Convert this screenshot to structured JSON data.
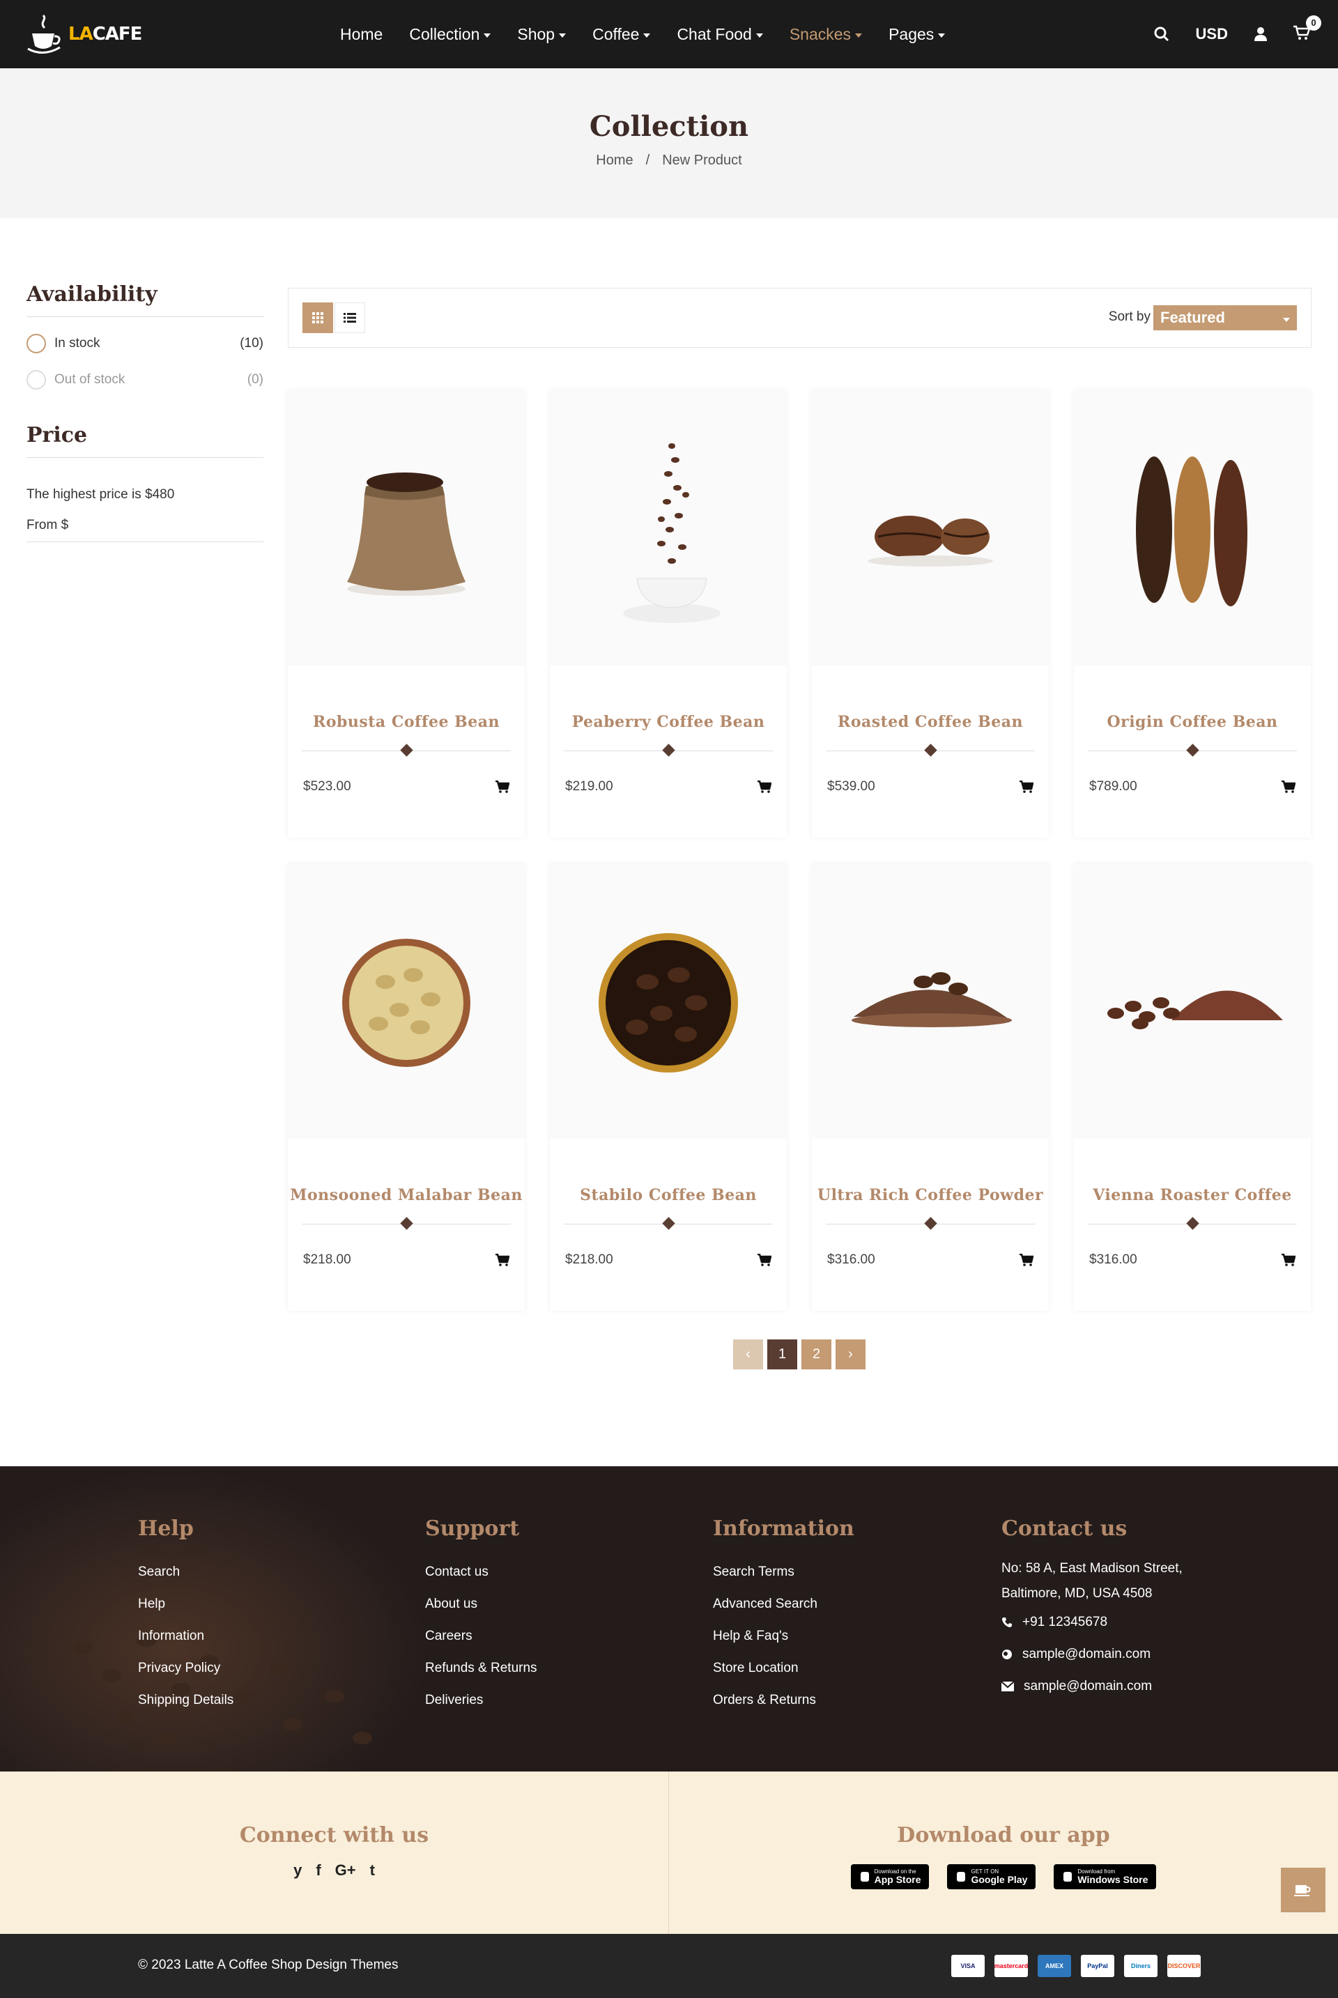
{
  "header": {
    "logo_prefix": "LA",
    "logo_suffix": "CAFE",
    "nav": [
      {
        "label": "Home",
        "dropdown": false,
        "active": false
      },
      {
        "label": "Collection",
        "dropdown": true,
        "active": false
      },
      {
        "label": "Shop",
        "dropdown": true,
        "active": false
      },
      {
        "label": "Coffee",
        "dropdown": true,
        "active": false
      },
      {
        "label": "Chat Food",
        "dropdown": true,
        "active": false
      },
      {
        "label": "Snackes",
        "dropdown": true,
        "active": true
      },
      {
        "label": "Pages",
        "dropdown": true,
        "active": false
      }
    ],
    "currency": "USD",
    "cart_count": "0"
  },
  "title_band": {
    "title": "Collection",
    "breadcrumb": [
      "Home",
      "/",
      "New Product"
    ]
  },
  "sidebar": {
    "availability_heading": "Availability",
    "availability": [
      {
        "label": "In stock",
        "count": "(10)"
      },
      {
        "label": "Out of stock",
        "count": "(0)"
      }
    ],
    "price_heading": "Price",
    "highest_price": "The highest price is $480",
    "from_label": "From $"
  },
  "toolbar": {
    "sort_label": "Sort by",
    "sort_value": "Featured"
  },
  "products": [
    {
      "name": "Robusta Coffee Bean",
      "price": "$523.00",
      "image": "coffee-sack"
    },
    {
      "name": "Peaberry Coffee Bean",
      "price": "$219.00",
      "image": "coffee-cup-beans"
    },
    {
      "name": "Roasted Coffee Bean",
      "price": "$539.00",
      "image": "two-beans"
    },
    {
      "name": "Origin Coffee Bean",
      "price": "$789.00",
      "image": "three-columns"
    },
    {
      "name": "Monsooned Malabar Bean",
      "price": "$218.00",
      "image": "green-beans-bowl"
    },
    {
      "name": "Stabilo Coffee Bean",
      "price": "$218.00",
      "image": "dark-beans-bowl"
    },
    {
      "name": "Ultra Rich Coffee Powder",
      "price": "$316.00",
      "image": "powder-pile"
    },
    {
      "name": "Vienna Roaster Coffee",
      "price": "$316.00",
      "image": "powder-and-beans"
    }
  ],
  "pagination": {
    "prev": "‹",
    "pages": [
      "1",
      "2"
    ],
    "current": "1",
    "next": "›"
  },
  "footer": {
    "columns": [
      {
        "heading": "Help",
        "links": [
          "Search",
          "Help",
          "Information",
          "Privacy Policy",
          "Shipping Details"
        ]
      },
      {
        "heading": "Support",
        "links": [
          "Contact us",
          "About us",
          "Careers",
          "Refunds & Returns",
          "Deliveries"
        ]
      },
      {
        "heading": "Information",
        "links": [
          "Search Terms",
          "Advanced Search",
          "Help & Faq's",
          "Store Location",
          "Orders & Returns"
        ]
      }
    ],
    "contact": {
      "heading": "Contact us",
      "address_line1": "No: 58 A, East Madison Street,",
      "address_line2": "Baltimore, MD, USA 4508",
      "phone": "+91 12345678",
      "email1": "sample@domain.com",
      "email2": "sample@domain.com"
    }
  },
  "connect": {
    "heading": "Connect with us",
    "social": [
      "twitter-icon",
      "facebook-icon",
      "google-plus-icon",
      "tumblr-icon"
    ],
    "social_glyphs": [
      "y",
      "f",
      "G+",
      "t"
    ]
  },
  "download": {
    "heading": "Download our app",
    "apps": [
      {
        "small": "Download on the",
        "big": "App Store"
      },
      {
        "small": "GET IT ON",
        "big": "Google Play"
      },
      {
        "small": "Download from",
        "big": "Windows Store"
      }
    ]
  },
  "bottom": {
    "copyright": "© 2023 Latte A Coffee Shop Design Themes",
    "payments": [
      "VISA",
      "mastercard",
      "AMEX",
      "PayPal",
      "Diners",
      "DISCOVER"
    ]
  },
  "colors": {
    "accent": "#c49b73",
    "dark": "#1b1b1b",
    "heading": "#3d2a26",
    "product_name": "#b3896a",
    "cream": "#f9efdb"
  }
}
